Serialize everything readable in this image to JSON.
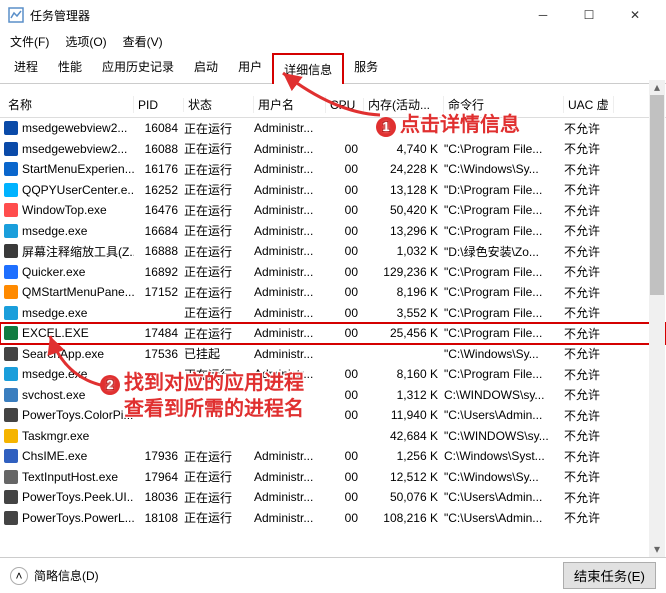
{
  "window": {
    "title": "任务管理器"
  },
  "menus": {
    "file": "文件(F)",
    "options": "选项(O)",
    "view": "查看(V)"
  },
  "tabs": {
    "processes": "进程",
    "performance": "性能",
    "apphistory": "应用历史记录",
    "startup": "启动",
    "users": "用户",
    "details": "详细信息",
    "services": "服务"
  },
  "columns": {
    "name": "名称",
    "pid": "PID",
    "status": "状态",
    "user": "用户名",
    "cpu": "CPU",
    "mem": "内存(活动...",
    "cmd": "命令行",
    "uac": "UAC 虚"
  },
  "rows": [
    {
      "name": "msedgewebview2...",
      "pid": "16084",
      "status": "正在运行",
      "user": "Administr...",
      "cpu": "",
      "mem": "",
      "cmd": "",
      "uac": "不允许",
      "icon": "#0a4aa8"
    },
    {
      "name": "msedgewebview2...",
      "pid": "16088",
      "status": "正在运行",
      "user": "Administr...",
      "cpu": "00",
      "mem": "4,740 K",
      "cmd": "\"C:\\Program File...",
      "uac": "不允许",
      "icon": "#0a4aa8"
    },
    {
      "name": "StartMenuExperien...",
      "pid": "16176",
      "status": "正在运行",
      "user": "Administr...",
      "cpu": "00",
      "mem": "24,228 K",
      "cmd": "\"C:\\Windows\\Sy...",
      "uac": "不允许",
      "icon": "#0a66cc"
    },
    {
      "name": "QQPYUserCenter.e...",
      "pid": "16252",
      "status": "正在运行",
      "user": "Administr...",
      "cpu": "00",
      "mem": "13,128 K",
      "cmd": "\"D:\\Program File...",
      "uac": "不允许",
      "icon": "#00b3ff"
    },
    {
      "name": "WindowTop.exe",
      "pid": "16476",
      "status": "正在运行",
      "user": "Administr...",
      "cpu": "00",
      "mem": "50,420 K",
      "cmd": "\"C:\\Program File...",
      "uac": "不允许",
      "icon": "#ff4d4d"
    },
    {
      "name": "msedge.exe",
      "pid": "16684",
      "status": "正在运行",
      "user": "Administr...",
      "cpu": "00",
      "mem": "13,296 K",
      "cmd": "\"C:\\Program File...",
      "uac": "不允许",
      "icon": "#1a9edb"
    },
    {
      "name": "屏幕注释缩放工具(Z...",
      "pid": "16888",
      "status": "正在运行",
      "user": "Administr...",
      "cpu": "00",
      "mem": "1,032 K",
      "cmd": "\"D:\\绿色安装\\Zo...",
      "uac": "不允许",
      "icon": "#3a3a3a"
    },
    {
      "name": "Quicker.exe",
      "pid": "16892",
      "status": "正在运行",
      "user": "Administr...",
      "cpu": "00",
      "mem": "129,236 K",
      "cmd": "\"C:\\Program File...",
      "uac": "不允许",
      "icon": "#1e6fff"
    },
    {
      "name": "QMStartMenuPane...",
      "pid": "17152",
      "status": "正在运行",
      "user": "Administr...",
      "cpu": "00",
      "mem": "8,196 K",
      "cmd": "\"C:\\Program File...",
      "uac": "不允许",
      "icon": "#ff8a00"
    },
    {
      "name": "msedge.exe",
      "pid": "",
      "status": "正在运行",
      "user": "Administr...",
      "cpu": "00",
      "mem": "3,552 K",
      "cmd": "\"C:\\Program File...",
      "uac": "不允许",
      "icon": "#1a9edb"
    },
    {
      "name": "EXCEL.EXE",
      "pid": "17484",
      "status": "正在运行",
      "user": "Administr...",
      "cpu": "00",
      "mem": "25,456 K",
      "cmd": "\"C:\\Program File...",
      "uac": "不允许",
      "icon": "#107c41",
      "hl": true
    },
    {
      "name": "SearchApp.exe",
      "pid": "17536",
      "status": "已挂起",
      "user": "Administr...",
      "cpu": "",
      "mem": "",
      "cmd": "\"C:\\Windows\\Sy...",
      "uac": "不允许",
      "icon": "#444"
    },
    {
      "name": "msedge.exe",
      "pid": "",
      "status": "正在运行",
      "user": "Administr...",
      "cpu": "00",
      "mem": "8,160 K",
      "cmd": "\"C:\\Program File...",
      "uac": "不允许",
      "icon": "#1a9edb"
    },
    {
      "name": "svchost.exe",
      "pid": "",
      "status": "",
      "user": "",
      "cpu": "00",
      "mem": "1,312 K",
      "cmd": "C:\\WINDOWS\\sy...",
      "uac": "不允许",
      "icon": "#3a7ebf"
    },
    {
      "name": "PowerToys.ColorPi...",
      "pid": "",
      "status": "",
      "user": "",
      "cpu": "00",
      "mem": "11,940 K",
      "cmd": "\"C:\\Users\\Admin...",
      "uac": "不允许",
      "icon": "#444"
    },
    {
      "name": "Taskmgr.exe",
      "pid": "",
      "status": "",
      "user": "",
      "cpu": "",
      "mem": "42,684 K",
      "cmd": "\"C:\\WINDOWS\\sy...",
      "uac": "不允许",
      "icon": "#f5b400"
    },
    {
      "name": "ChsIME.exe",
      "pid": "17936",
      "status": "正在运行",
      "user": "Administr...",
      "cpu": "00",
      "mem": "1,256 K",
      "cmd": "C:\\Windows\\Syst...",
      "uac": "不允许",
      "icon": "#3060c0"
    },
    {
      "name": "TextInputHost.exe",
      "pid": "17964",
      "status": "正在运行",
      "user": "Administr...",
      "cpu": "00",
      "mem": "12,512 K",
      "cmd": "\"C:\\Windows\\Sy...",
      "uac": "不允许",
      "icon": "#666"
    },
    {
      "name": "PowerToys.Peek.UI...",
      "pid": "18036",
      "status": "正在运行",
      "user": "Administr...",
      "cpu": "00",
      "mem": "50,076 K",
      "cmd": "\"C:\\Users\\Admin...",
      "uac": "不允许",
      "icon": "#444"
    },
    {
      "name": "PowerToys.PowerL...",
      "pid": "18108",
      "status": "正在运行",
      "user": "Administr...",
      "cpu": "00",
      "mem": "108,216 K",
      "cmd": "\"C:\\Users\\Admin...",
      "uac": "不允许",
      "icon": "#444"
    }
  ],
  "statusbar": {
    "fewer": "简略信息(D)",
    "endtask": "结束任务(E)"
  },
  "callouts": {
    "c1_num": "1",
    "c1_text": "点击详情信息",
    "c2_num": "2",
    "c2_line1": "找到对应的应用进程",
    "c2_line2": "查看到所需的进程名"
  }
}
